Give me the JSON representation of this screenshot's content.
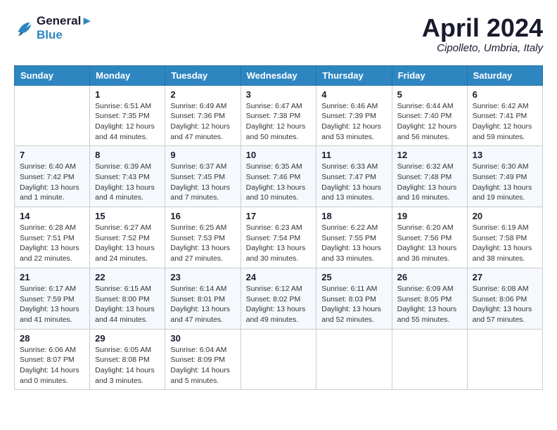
{
  "header": {
    "logo_line1": "General",
    "logo_line2": "Blue",
    "month_title": "April 2024",
    "subtitle": "Cipolleto, Umbria, Italy"
  },
  "days_of_week": [
    "Sunday",
    "Monday",
    "Tuesday",
    "Wednesday",
    "Thursday",
    "Friday",
    "Saturday"
  ],
  "weeks": [
    [
      {
        "day": "",
        "info": ""
      },
      {
        "day": "1",
        "info": "Sunrise: 6:51 AM\nSunset: 7:35 PM\nDaylight: 12 hours\nand 44 minutes."
      },
      {
        "day": "2",
        "info": "Sunrise: 6:49 AM\nSunset: 7:36 PM\nDaylight: 12 hours\nand 47 minutes."
      },
      {
        "day": "3",
        "info": "Sunrise: 6:47 AM\nSunset: 7:38 PM\nDaylight: 12 hours\nand 50 minutes."
      },
      {
        "day": "4",
        "info": "Sunrise: 6:46 AM\nSunset: 7:39 PM\nDaylight: 12 hours\nand 53 minutes."
      },
      {
        "day": "5",
        "info": "Sunrise: 6:44 AM\nSunset: 7:40 PM\nDaylight: 12 hours\nand 56 minutes."
      },
      {
        "day": "6",
        "info": "Sunrise: 6:42 AM\nSunset: 7:41 PM\nDaylight: 12 hours\nand 59 minutes."
      }
    ],
    [
      {
        "day": "7",
        "info": "Sunrise: 6:40 AM\nSunset: 7:42 PM\nDaylight: 13 hours\nand 1 minute."
      },
      {
        "day": "8",
        "info": "Sunrise: 6:39 AM\nSunset: 7:43 PM\nDaylight: 13 hours\nand 4 minutes."
      },
      {
        "day": "9",
        "info": "Sunrise: 6:37 AM\nSunset: 7:45 PM\nDaylight: 13 hours\nand 7 minutes."
      },
      {
        "day": "10",
        "info": "Sunrise: 6:35 AM\nSunset: 7:46 PM\nDaylight: 13 hours\nand 10 minutes."
      },
      {
        "day": "11",
        "info": "Sunrise: 6:33 AM\nSunset: 7:47 PM\nDaylight: 13 hours\nand 13 minutes."
      },
      {
        "day": "12",
        "info": "Sunrise: 6:32 AM\nSunset: 7:48 PM\nDaylight: 13 hours\nand 16 minutes."
      },
      {
        "day": "13",
        "info": "Sunrise: 6:30 AM\nSunset: 7:49 PM\nDaylight: 13 hours\nand 19 minutes."
      }
    ],
    [
      {
        "day": "14",
        "info": "Sunrise: 6:28 AM\nSunset: 7:51 PM\nDaylight: 13 hours\nand 22 minutes."
      },
      {
        "day": "15",
        "info": "Sunrise: 6:27 AM\nSunset: 7:52 PM\nDaylight: 13 hours\nand 24 minutes."
      },
      {
        "day": "16",
        "info": "Sunrise: 6:25 AM\nSunset: 7:53 PM\nDaylight: 13 hours\nand 27 minutes."
      },
      {
        "day": "17",
        "info": "Sunrise: 6:23 AM\nSunset: 7:54 PM\nDaylight: 13 hours\nand 30 minutes."
      },
      {
        "day": "18",
        "info": "Sunrise: 6:22 AM\nSunset: 7:55 PM\nDaylight: 13 hours\nand 33 minutes."
      },
      {
        "day": "19",
        "info": "Sunrise: 6:20 AM\nSunset: 7:56 PM\nDaylight: 13 hours\nand 36 minutes."
      },
      {
        "day": "20",
        "info": "Sunrise: 6:19 AM\nSunset: 7:58 PM\nDaylight: 13 hours\nand 38 minutes."
      }
    ],
    [
      {
        "day": "21",
        "info": "Sunrise: 6:17 AM\nSunset: 7:59 PM\nDaylight: 13 hours\nand 41 minutes."
      },
      {
        "day": "22",
        "info": "Sunrise: 6:15 AM\nSunset: 8:00 PM\nDaylight: 13 hours\nand 44 minutes."
      },
      {
        "day": "23",
        "info": "Sunrise: 6:14 AM\nSunset: 8:01 PM\nDaylight: 13 hours\nand 47 minutes."
      },
      {
        "day": "24",
        "info": "Sunrise: 6:12 AM\nSunset: 8:02 PM\nDaylight: 13 hours\nand 49 minutes."
      },
      {
        "day": "25",
        "info": "Sunrise: 6:11 AM\nSunset: 8:03 PM\nDaylight: 13 hours\nand 52 minutes."
      },
      {
        "day": "26",
        "info": "Sunrise: 6:09 AM\nSunset: 8:05 PM\nDaylight: 13 hours\nand 55 minutes."
      },
      {
        "day": "27",
        "info": "Sunrise: 6:08 AM\nSunset: 8:06 PM\nDaylight: 13 hours\nand 57 minutes."
      }
    ],
    [
      {
        "day": "28",
        "info": "Sunrise: 6:06 AM\nSunset: 8:07 PM\nDaylight: 14 hours\nand 0 minutes."
      },
      {
        "day": "29",
        "info": "Sunrise: 6:05 AM\nSunset: 8:08 PM\nDaylight: 14 hours\nand 3 minutes."
      },
      {
        "day": "30",
        "info": "Sunrise: 6:04 AM\nSunset: 8:09 PM\nDaylight: 14 hours\nand 5 minutes."
      },
      {
        "day": "",
        "info": ""
      },
      {
        "day": "",
        "info": ""
      },
      {
        "day": "",
        "info": ""
      },
      {
        "day": "",
        "info": ""
      }
    ]
  ]
}
